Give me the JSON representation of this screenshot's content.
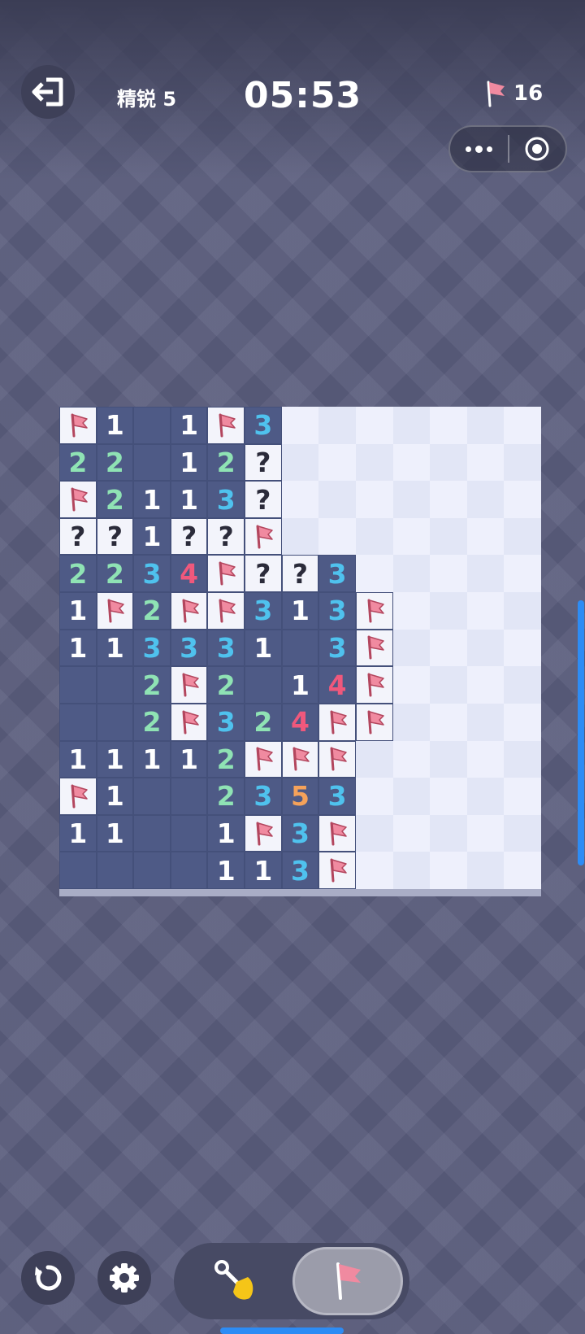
{
  "header": {
    "level_label": "精锐 5",
    "timer": "05:53",
    "flags_remaining": "16"
  },
  "board": {
    "rows": 13,
    "cols": 13,
    "legend": "F = flag, ? = question mark, . = revealed empty, # = unrevealed, digits = revealed count",
    "cells": [
      [
        "F",
        "1",
        ".",
        "1",
        "F",
        "3",
        "#",
        "#",
        "#",
        "#",
        "#",
        "#",
        "#"
      ],
      [
        "2",
        "2",
        ".",
        "1",
        "2",
        "?",
        "#",
        "#",
        "#",
        "#",
        "#",
        "#",
        "#"
      ],
      [
        "F",
        "2",
        "1",
        "1",
        "3",
        "?",
        "#",
        "#",
        "#",
        "#",
        "#",
        "#",
        "#"
      ],
      [
        "?",
        "?",
        "1",
        "?",
        "?",
        "F",
        "#",
        "#",
        "#",
        "#",
        "#",
        "#",
        "#"
      ],
      [
        "2",
        "2",
        "3",
        "4",
        "F",
        "?",
        "?",
        "3",
        "#",
        "#",
        "#",
        "#",
        "#"
      ],
      [
        "1",
        "F",
        "2",
        "F",
        "F",
        "3",
        "1",
        "3",
        "F",
        "#",
        "#",
        "#",
        "#"
      ],
      [
        "1",
        "1",
        "3",
        "3",
        "3",
        "1",
        ".",
        "3",
        "F",
        "#",
        "#",
        "#",
        "#"
      ],
      [
        ".",
        ".",
        "2",
        "F",
        "2",
        ".",
        "1",
        "4",
        "F",
        "#",
        "#",
        "#",
        "#"
      ],
      [
        ".",
        ".",
        "2",
        "F",
        "3",
        "2",
        "4",
        "F",
        "F",
        "#",
        "#",
        "#",
        "#"
      ],
      [
        "1",
        "1",
        "1",
        "1",
        "2",
        "F",
        "F",
        "F",
        "#",
        "#",
        "#",
        "#",
        "#"
      ],
      [
        "F",
        "1",
        ".",
        ".",
        "2",
        "3",
        "5",
        "3",
        "#",
        "#",
        "#",
        "#",
        "#"
      ],
      [
        "1",
        "1",
        ".",
        ".",
        "1",
        "F",
        "3",
        "F",
        "#",
        "#",
        "#",
        "#",
        "#"
      ],
      [
        ".",
        ".",
        ".",
        ".",
        "1",
        "1",
        "3",
        "F",
        "#",
        "#",
        "#",
        "#",
        "#"
      ]
    ],
    "number_colors": {
      "1": "#ffffff",
      "2": "#8fe3b4",
      "3": "#4fc2ee",
      "4": "#f0587c",
      "5": "#f5a25a"
    },
    "flag_color": "#f08aa0"
  },
  "controls": {
    "exit_icon": "exit-icon",
    "restart_icon": "restart-icon",
    "settings_icon": "gear-icon",
    "dig_mode_icon": "shovel-icon",
    "flag_mode_icon": "flag-icon",
    "active_mode": "flag"
  }
}
